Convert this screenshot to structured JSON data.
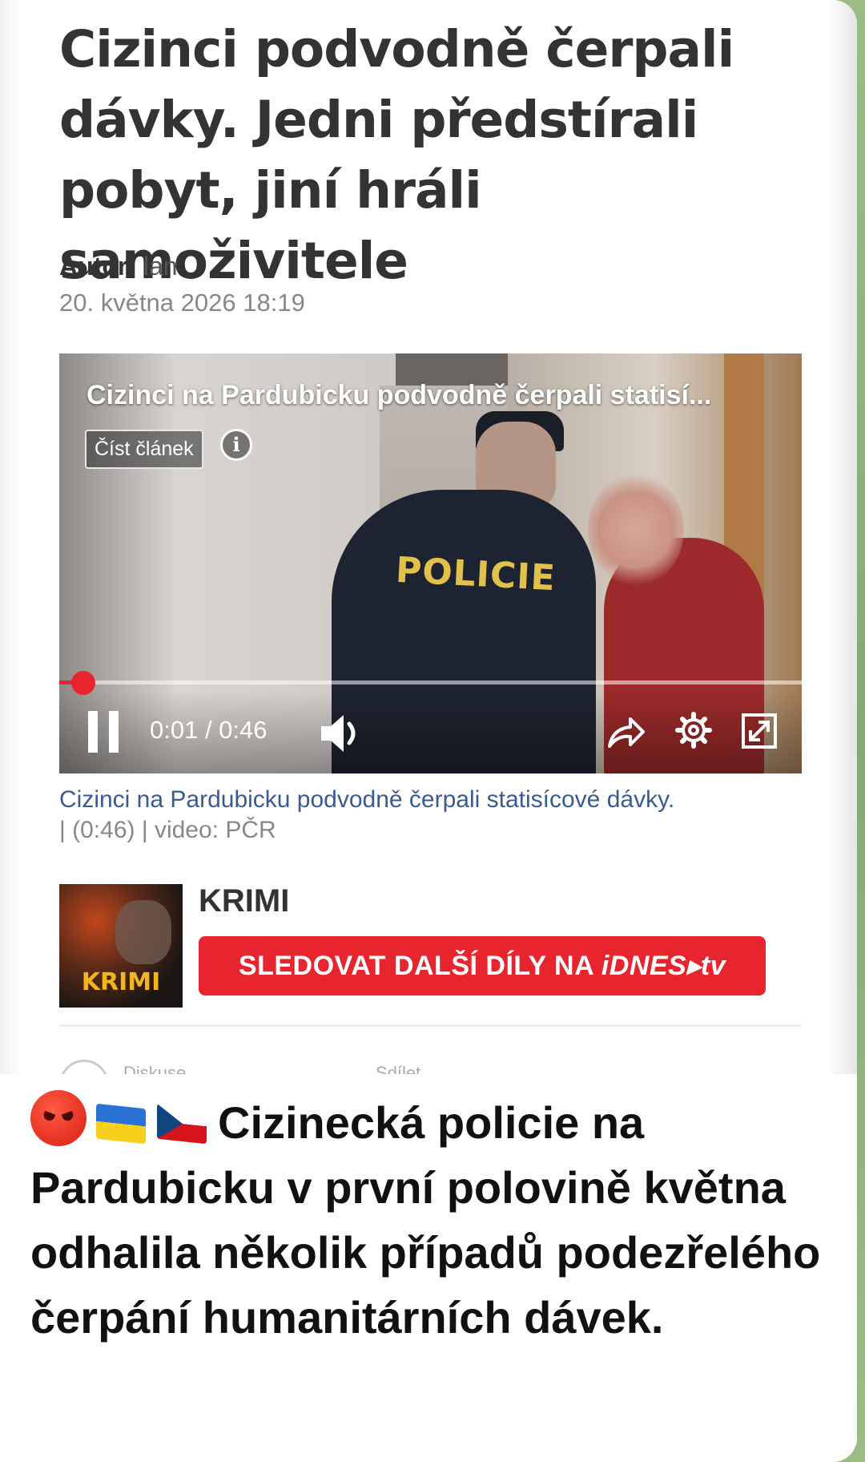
{
  "article": {
    "headline": "Cizinci podvodně čerpali dávky. Jedni předstírali pobyt, jiní hráli samoživitele",
    "author_label": "Autor:",
    "author_name": "lan",
    "date": "20. května 2026  18:19"
  },
  "video": {
    "overlay_title": "Cizinci na Pardubicku podvodně čerpali statisí...",
    "read_article_label": "Číst článek",
    "info_icon": "info-icon",
    "scene_text": "POLICIE",
    "time": "0:01 / 0:46",
    "progress": 0.022,
    "controls": [
      "pause-icon",
      "volume-icon",
      "share-icon",
      "gear-icon",
      "fullscreen-icon"
    ],
    "caption": "Cizinci na Pardubicku podvodně čerpali statisícové dávky.",
    "caption_meta": "| (0:46) | video: PČR"
  },
  "promo": {
    "thumb_text": "KRIMI",
    "title": "KRIMI",
    "button_label": "SLEDOVAT DALŠÍ DÍLY NA ",
    "button_brand": "iDNES▸tv"
  },
  "footer_cut": {
    "discussion": "Diskuse",
    "share": "Sdílet"
  },
  "post": {
    "emojis": [
      "angry-face",
      "ukraine-flag",
      "czech-flag"
    ],
    "text": "Cizinecká policie na Pardubicku v první polovině května odhalila několik případů podezřelého čerpání humanitárních dávek."
  },
  "colors": {
    "accent_red": "#e8252e",
    "caption_blue": "#3b5b8f",
    "background_green": "#8fb07c"
  }
}
